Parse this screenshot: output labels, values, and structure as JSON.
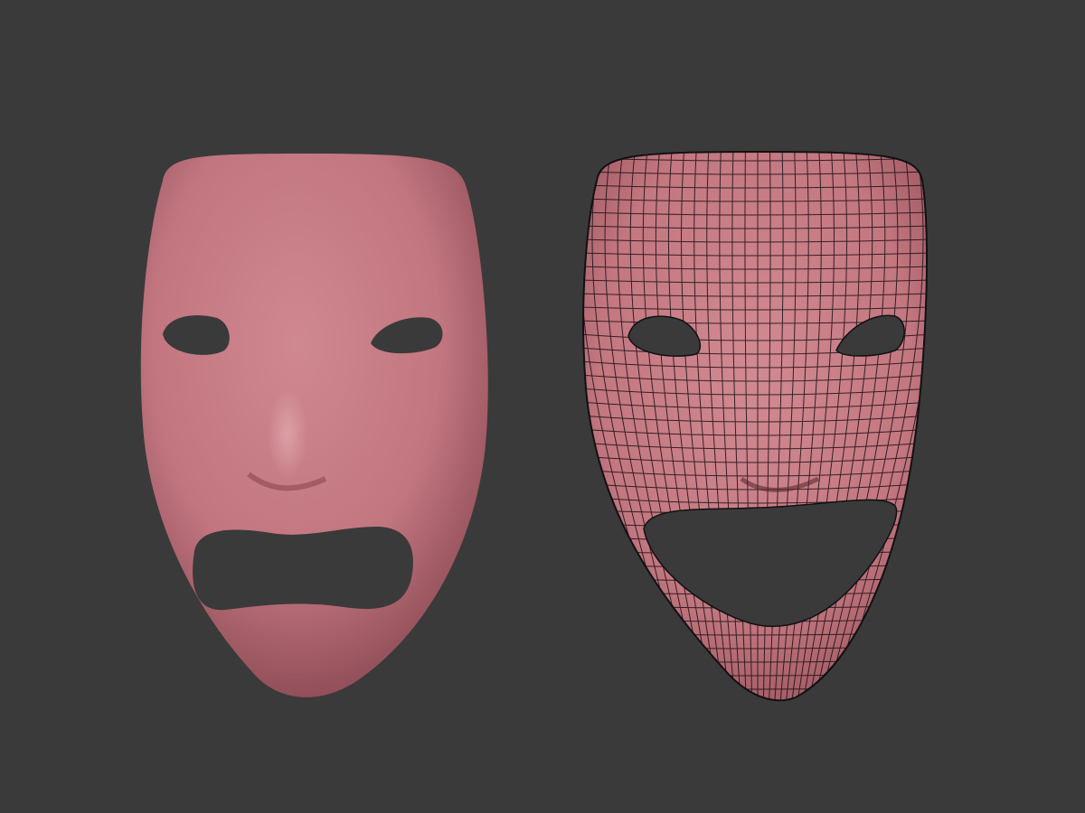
{
  "colors": {
    "background": "#3a3a3a",
    "mask_skin": "#c47a83",
    "mask_highlight": "#d9959c",
    "mask_shadow": "#8f4c56",
    "wire": "#1a1014"
  },
  "scene": {
    "left_mask": "tragedy-mask-smooth",
    "right_mask": "comedy-mask-wireframe"
  }
}
